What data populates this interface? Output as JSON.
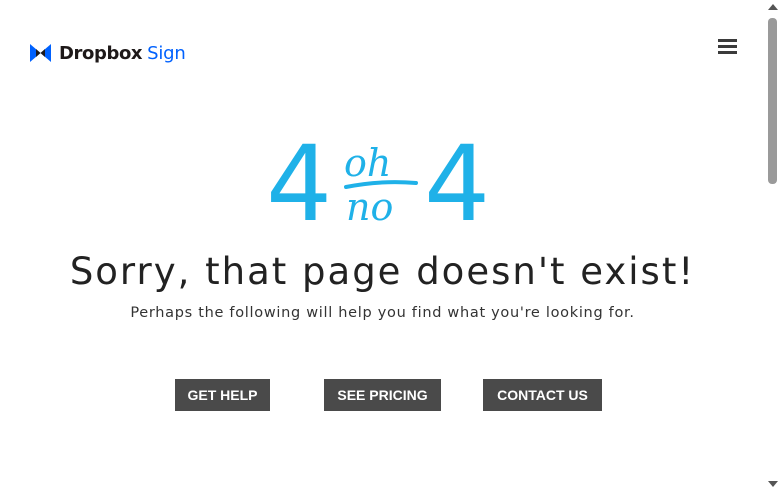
{
  "brand": {
    "logo_icon": "dropbox-logo-icon",
    "name": "Dropbox",
    "product": "Sign",
    "name_color": "#1e1919",
    "product_color": "#0061fe"
  },
  "header": {
    "menu_icon": "hamburger-menu-icon"
  },
  "error_art": {
    "left_digit": "4",
    "right_digit": "4",
    "top_word": "oh",
    "bottom_word": "no",
    "color": "#1fb1e8"
  },
  "main": {
    "title": "Sorry, that page doesn't exist!",
    "subtitle": "Perhaps the following will help you find what you're looking for."
  },
  "buttons": {
    "help": "GET HELP",
    "pricing": "SEE PRICING",
    "contact": "CONTACT US",
    "background": "#4a4a4a"
  },
  "scrollbar": {
    "thumb_color": "#9a9a9a"
  }
}
